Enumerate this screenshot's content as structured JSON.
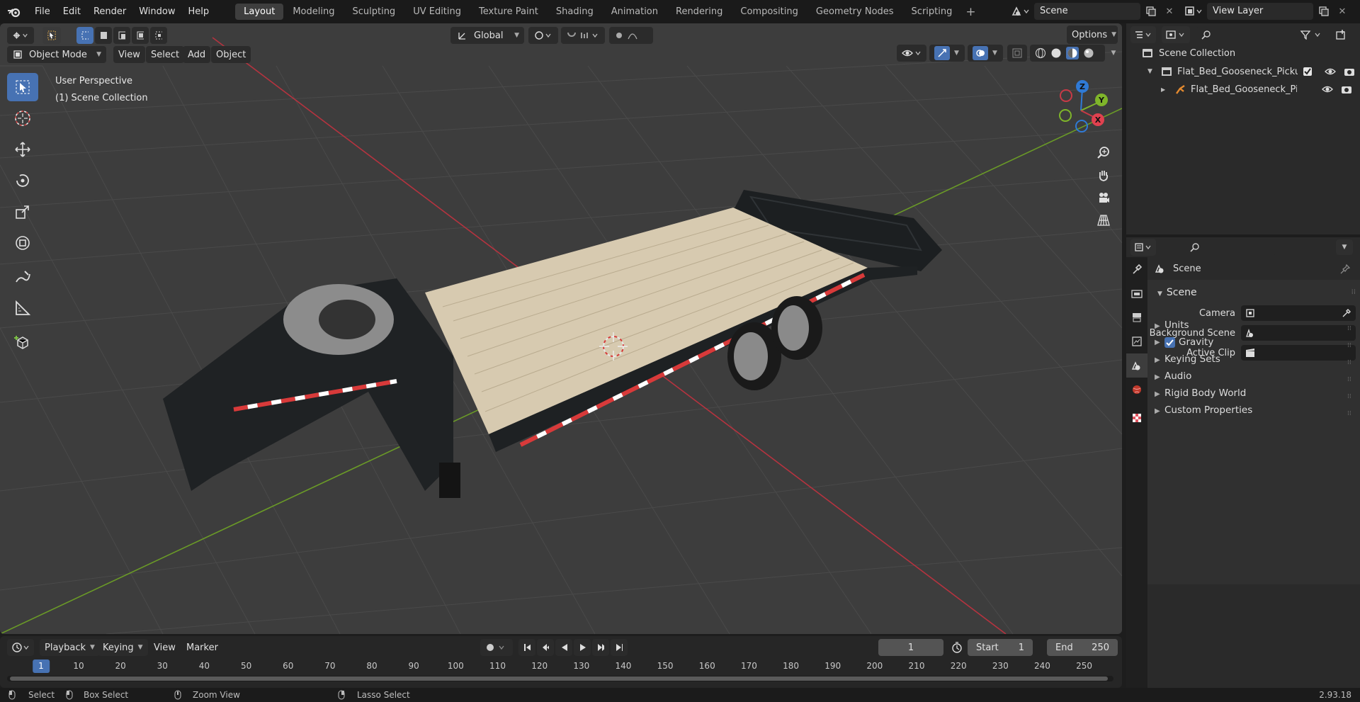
{
  "topbar": {
    "menus": [
      "File",
      "Edit",
      "Render",
      "Window",
      "Help"
    ],
    "workspaces": [
      "Layout",
      "Modeling",
      "Sculpting",
      "UV Editing",
      "Texture Paint",
      "Shading",
      "Animation",
      "Rendering",
      "Compositing",
      "Geometry Nodes",
      "Scripting"
    ],
    "active_workspace": "Layout",
    "scene_name": "Scene",
    "view_layer": "View Layer"
  },
  "viewport": {
    "mode": "Object Mode",
    "menus": [
      "View",
      "Select",
      "Add",
      "Object"
    ],
    "transform_orientation": "Global",
    "options_label": "Options",
    "overlay_title": "User Perspective",
    "overlay_subtitle": "(1) Scene Collection",
    "gizmo_axes": [
      "Z",
      "Y",
      "X"
    ]
  },
  "outliner": {
    "root": "Scene Collection",
    "items": [
      {
        "label": "Flat_Bed_Gooseneck_Pickup_"
      },
      {
        "label": "Flat_Bed_Gooseneck_Pic"
      }
    ]
  },
  "properties": {
    "context_label": "Scene",
    "panel_title": "Scene",
    "fields": [
      {
        "label": "Camera"
      },
      {
        "label": "Background Scene"
      },
      {
        "label": "Active Clip"
      }
    ],
    "sections": [
      "Units",
      "Gravity",
      "Keying Sets",
      "Audio",
      "Rigid Body World",
      "Custom Properties"
    ],
    "gravity_checked": true
  },
  "timeline": {
    "menus": [
      "Playback",
      "Keying",
      "View",
      "Marker"
    ],
    "current_frame": "1",
    "start_label": "Start",
    "start_value": "1",
    "end_label": "End",
    "end_value": "250",
    "ruler": [
      "1",
      "10",
      "20",
      "30",
      "40",
      "50",
      "60",
      "70",
      "80",
      "90",
      "100",
      "110",
      "120",
      "130",
      "140",
      "150",
      "160",
      "170",
      "180",
      "190",
      "200",
      "210",
      "220",
      "230",
      "240",
      "250"
    ]
  },
  "status": {
    "select": "Select",
    "box_select": "Box Select",
    "zoom_view": "Zoom View",
    "lasso_select": "Lasso Select",
    "version": "2.93.18"
  },
  "colors": {
    "accent": "#4772b3",
    "x_axis": "#c83a46",
    "y_axis": "#7fb52a",
    "z_axis": "#2f7ad6"
  }
}
